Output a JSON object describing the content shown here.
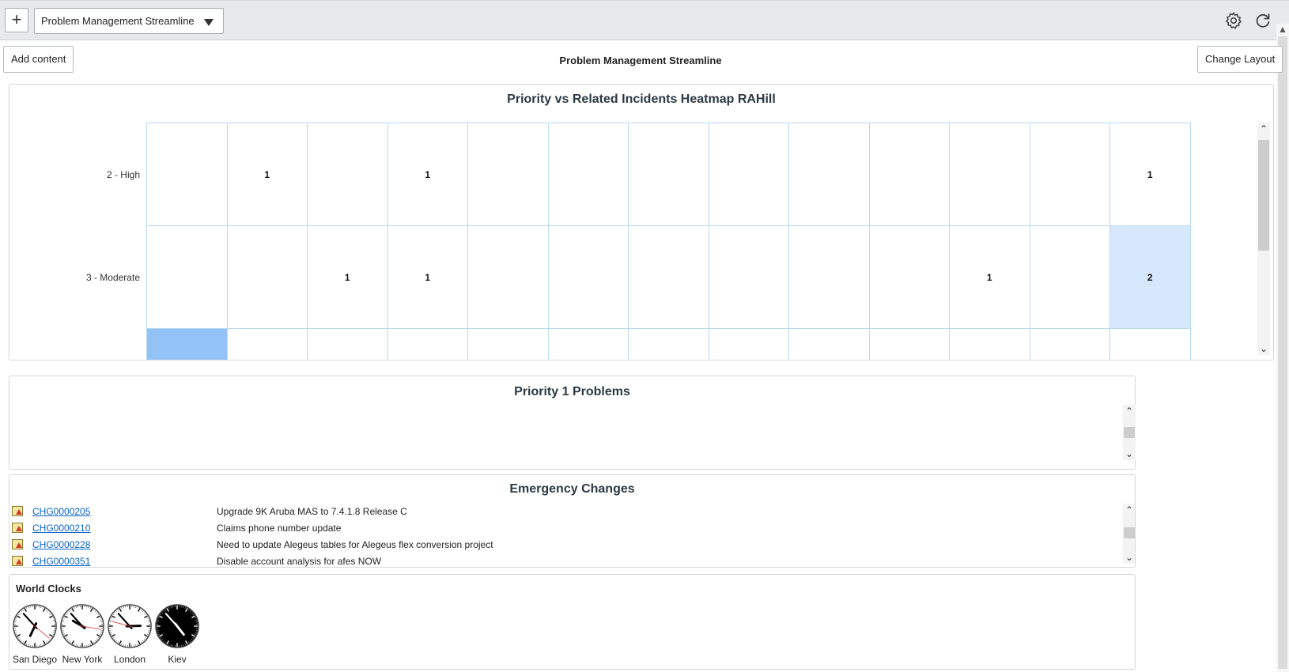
{
  "toolbar": {
    "add_label": "+",
    "dashboard_name": "Problem Management Streamline"
  },
  "page": {
    "title": "Problem Management Streamline",
    "add_content_label": "Add content",
    "change_layout_label": "Change Layout"
  },
  "heatmap": {
    "title": "Priority vs Related Incidents Heatmap RAHill",
    "rows": [
      {
        "label": "2 - High",
        "cells": [
          "",
          "1",
          "",
          "1",
          "",
          "",
          "",
          "",
          "",
          "",
          "",
          "",
          "1"
        ]
      },
      {
        "label": "3 - Moderate",
        "cells": [
          "",
          "",
          "1",
          "1",
          "",
          "",
          "",
          "",
          "",
          "",
          "1",
          "",
          "2"
        ]
      }
    ],
    "colors": {
      "highlight": "#d6e8fb",
      "bottom_first": "#93c3f6",
      "grid": "#b9d9f2"
    }
  },
  "priority1": {
    "title": "Priority 1 Problems"
  },
  "emergency": {
    "title": "Emergency Changes",
    "items": [
      {
        "number": "CHG0000205",
        "description": "Upgrade 9K Aruba MAS to 7.4.1.8 Release C"
      },
      {
        "number": "CHG0000210",
        "description": "Claims phone number update"
      },
      {
        "number": "CHG0000228",
        "description": "Need to update Alegeus tables for Alegeus flex conversion project"
      },
      {
        "number": "CHG0000351",
        "description": "Disable account analysis for afes NOW"
      }
    ]
  },
  "world_clocks": {
    "title": "World Clocks",
    "clocks": [
      {
        "city": "San Diego",
        "hour_deg": 205,
        "minute_deg": 318,
        "second_deg": 130,
        "dark": false
      },
      {
        "city": "New York",
        "hour_deg": 300,
        "minute_deg": 318,
        "second_deg": 100,
        "dark": false
      },
      {
        "city": "London",
        "hour_deg": 88,
        "minute_deg": 318,
        "second_deg": 285,
        "dark": false
      },
      {
        "city": "Kiev",
        "hour_deg": 142,
        "minute_deg": 318,
        "second_deg": 0,
        "dark": true
      }
    ]
  }
}
